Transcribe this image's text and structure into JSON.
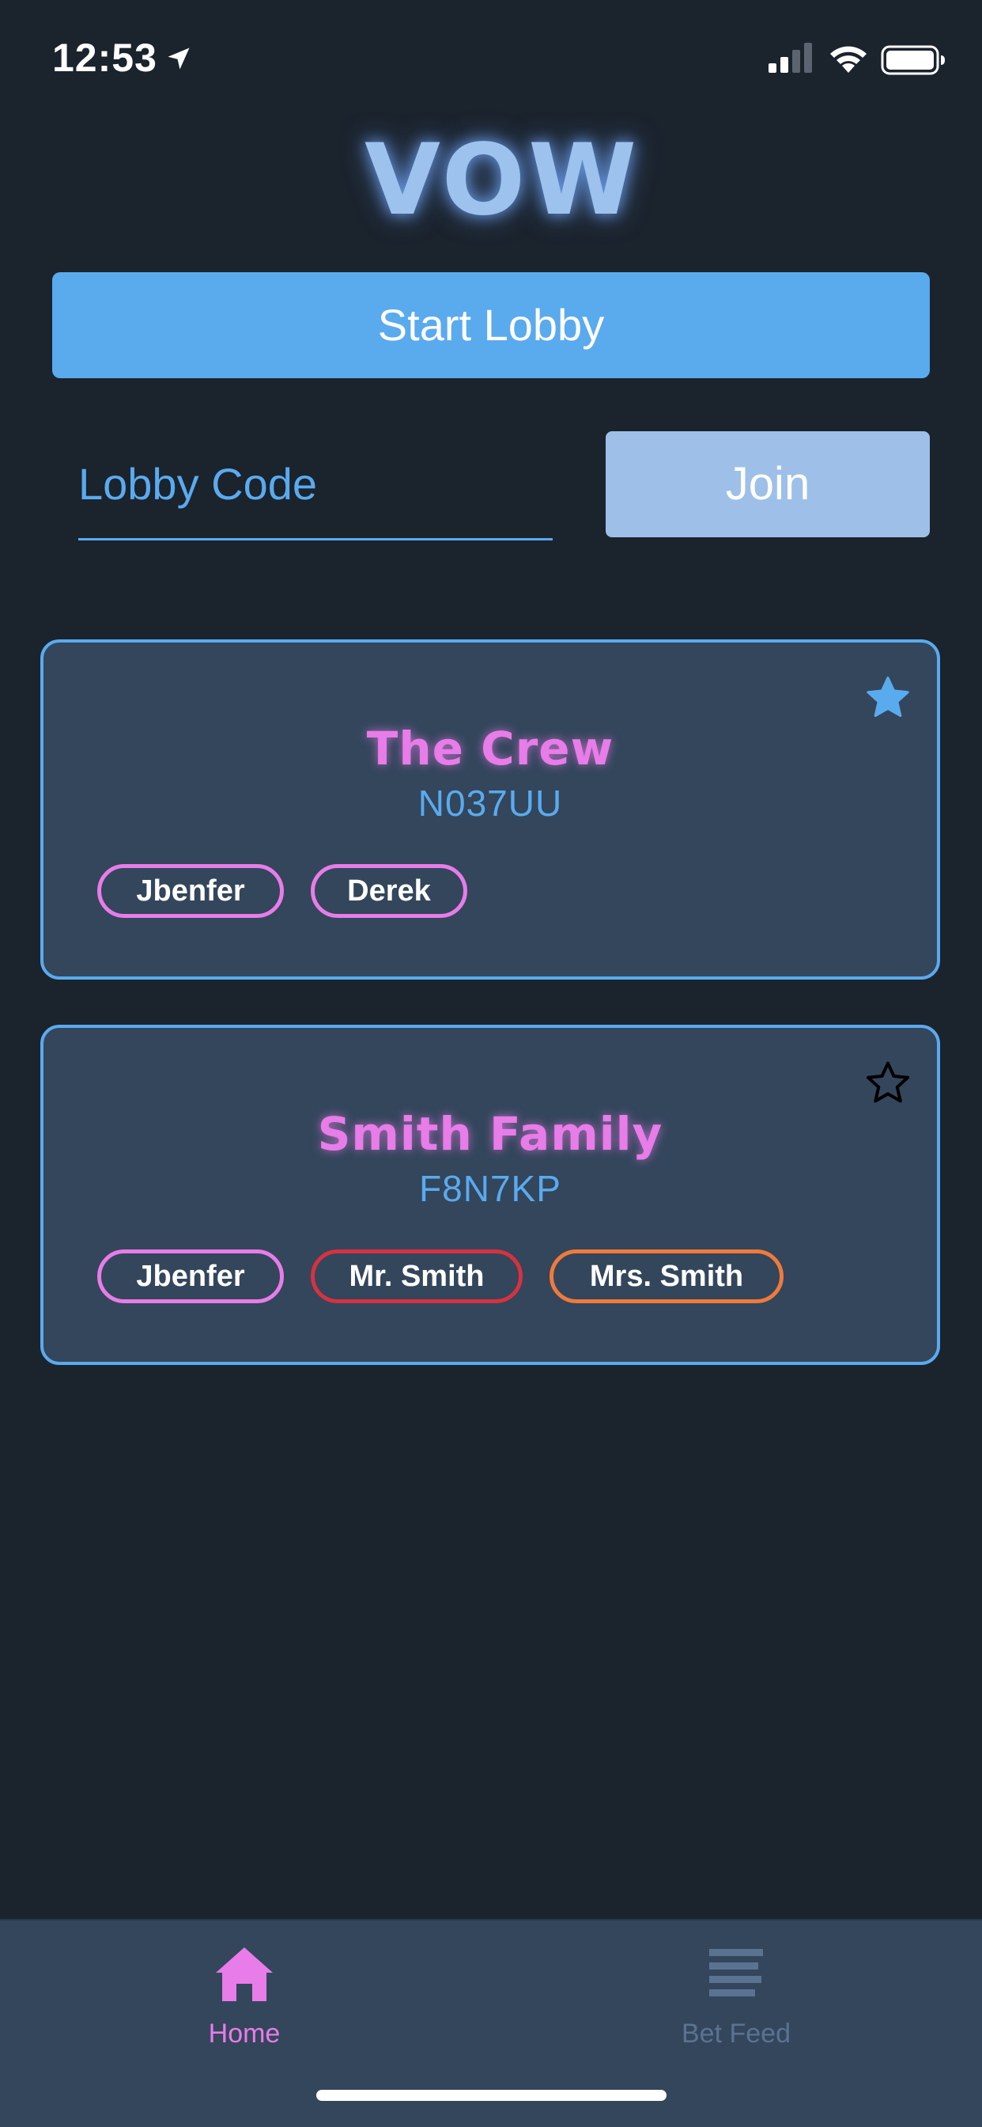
{
  "status_bar": {
    "time": "12:53"
  },
  "app": {
    "logo_text": "VOW"
  },
  "actions": {
    "start_lobby_label": "Start Lobby",
    "lobby_code_placeholder": "Lobby Code",
    "join_label": "Join"
  },
  "lobbies": [
    {
      "name": "The Crew",
      "code": "N037UU",
      "favorite": true,
      "members": [
        {
          "name": "Jbenfer",
          "color": "#e87ce8"
        },
        {
          "name": "Derek",
          "color": "#e87ce8"
        }
      ]
    },
    {
      "name": "Smith Family",
      "code": "F8N7KP",
      "favorite": false,
      "members": [
        {
          "name": "Jbenfer",
          "color": "#e87ce8"
        },
        {
          "name": "Mr. Smith",
          "color": "#d8313f"
        },
        {
          "name": "Mrs. Smith",
          "color": "#f07a3a"
        }
      ]
    }
  ],
  "tab_bar": {
    "tabs": [
      {
        "label": "Home",
        "icon": "home-icon",
        "active": true,
        "color": "#e87ce8"
      },
      {
        "label": "Bet Feed",
        "icon": "list-icon",
        "active": false,
        "color": "#5a7391"
      }
    ]
  },
  "colors": {
    "background": "#1b232d",
    "card": "#33465c",
    "accent_blue": "#5aaaee",
    "accent_pink": "#e87ce8",
    "join_button": "#9ec0e8"
  }
}
